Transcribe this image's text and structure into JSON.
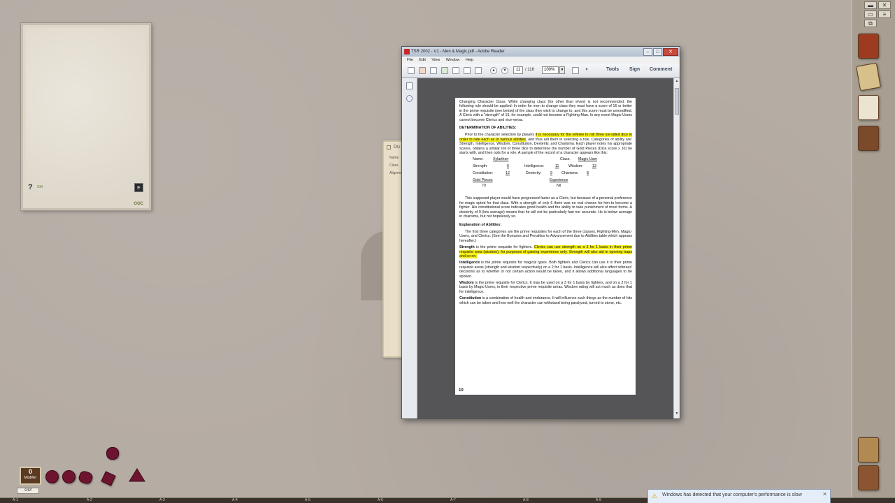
{
  "notes": {
    "gm_label": "GM",
    "ooc_label": "OOC",
    "help_icon": "?",
    "button_label": "E"
  },
  "char_sheet": {
    "title": "Du",
    "fields": [
      "Name",
      "Class",
      "Alignme"
    ]
  },
  "sidebar": {
    "icons": [
      "spellbook-icon",
      "map-icon",
      "character-icon",
      "portrait-icon",
      "library-icon",
      "tokens-icon"
    ]
  },
  "modifier": {
    "value": "0",
    "label": "Modifier"
  },
  "gm_badge": "GM",
  "dice": [
    "d4",
    "d6",
    "d8",
    "d10",
    "d12",
    "d20"
  ],
  "ruler_marks": [
    "A-1",
    "A-2",
    "A-3",
    "A-4",
    "A-5",
    "A-6",
    "A-7",
    "A-8",
    "A-9"
  ],
  "toast": {
    "message": "Windows has detected that your computer's performance is slow"
  },
  "reader": {
    "title": "TSR 2002 - V1 - Men & Magic.pdf - Adobe Reader",
    "window_buttons": [
      "–",
      "□",
      "✕"
    ],
    "menu": [
      "File",
      "Edit",
      "View",
      "Window",
      "Help"
    ],
    "page_current": "11",
    "page_total": "/ 116",
    "zoom": "100%",
    "tools_label": "Tools",
    "sign_label": "Sign",
    "comment_label": "Comment",
    "document": {
      "p_changing_class": "Changing Character Class: While changing class (for other than elves) is not recommended, the following rule should be applied: In order for men to change class they must have a score of 16 or better in the prime requisite (see below) of the class they wish to change to, and this score must be unmodified. A Cleric with a \"strength\" of 15, for example, could not become a Fighting-Man. In any event Magic-Users cannot become Clerics and vice-versa.",
      "h_determination": "DETERMINATION OF ABILITIES:",
      "p_prior_a": "Prior to the character selection by players ",
      "p_prior_hl": "it is necessary for the referee to roll three six-sided dice in order to rate each as to various abilities",
      "p_prior_b": ", and thus aid them in selecting a role. Categories of ability are: Strength, Intelligence, Wisdom, Constitution, Dexterity, and Charisma. Each player notes his appropriate scores, obtains a similar roll of three dice to determine the number of Gold Pieces (Dice score x 10) he starts with, and then opts for a role. A sample of the record of a character appears like this:",
      "stats": {
        "name_label": "Name:",
        "name_value": "Xylarthen",
        "class_label": "Class:",
        "class_value": "Magic-User",
        "strength_label": "Strength:",
        "strength_value": "6",
        "intelligence_label": "Intelligence:",
        "intelligence_value": "11",
        "wisdom_label": "Wisdom:",
        "wisdom_value": "13",
        "constitution_label": "Constitution:",
        "constitution_value": "12",
        "dexterity_label": "Dexterity:",
        "dexterity_value": "9",
        "charisma_label": "Charisma:",
        "charisma_value": "8",
        "gold_label": "Gold Pieces",
        "gold_value": "70",
        "experience_label": "Experience",
        "experience_value": "Nil"
      },
      "p_supposed": "This supposed player would have progressed faster as a Cleric, but because of a personal preference for magic opted for that class. With a strength of only 6 there was no real chance for him to become a fighter. His constitutional score indicates good health and the ability to take punishment of most forms. A dexterity of 9 (low average) means that he will not be particularly fast nor accurate. He is below average in charisma, but not hopelessly so.",
      "h_explanation": "Explanation of Abilities:",
      "p_first_three": "The first three categories are the prime requisites for each of the three classes, Fighting-Men, Magic-Users, and Clerics. (See the Bonuses and Penalties to Advancement due to Abilities table which appears hereafter.)",
      "p_strength_bold": "Strength",
      "p_strength_a": " is the prime requisite for fighters. ",
      "p_strength_hl": "Clerics can use strength on a 3 for 1 basis in their prime requisite area (wisdom), for purposes of gaining experience only. Strength will also aid in opening traps and so on.",
      "p_intelligence_bold": "Intelligence",
      "p_intelligence": " is the prime requisite for magical types. Both fighters and Clerics can use it in their prime requisite areas (strength and wisdom respectively) on a 2 for 1 basis. Intelligence will also affect referees' decisions as to whether or not certain action would be taken, and it allows additional languages to be spoken.",
      "p_wisdom_bold": "Wisdom",
      "p_wisdom": " is the prime requisite for Clerics. It may be used on a 3 for 1 basis by fighters, and on a 2 for 1 basis by Magic-Users, in their respective prime requisite areas. Wisdom rating will act much as does that for intelligence.",
      "p_constitution_bold": "Constitution",
      "p_constitution": " is a combination of health and endurance. It will influence such things as the number of hits which can be taken and how well the character can withstand being paralyzed, turned to stone, etc.",
      "page_number": "10"
    }
  },
  "colors": {
    "highlight": "#f5ef1c",
    "dice": "#6e1430",
    "desktop": "#b5aca4"
  }
}
